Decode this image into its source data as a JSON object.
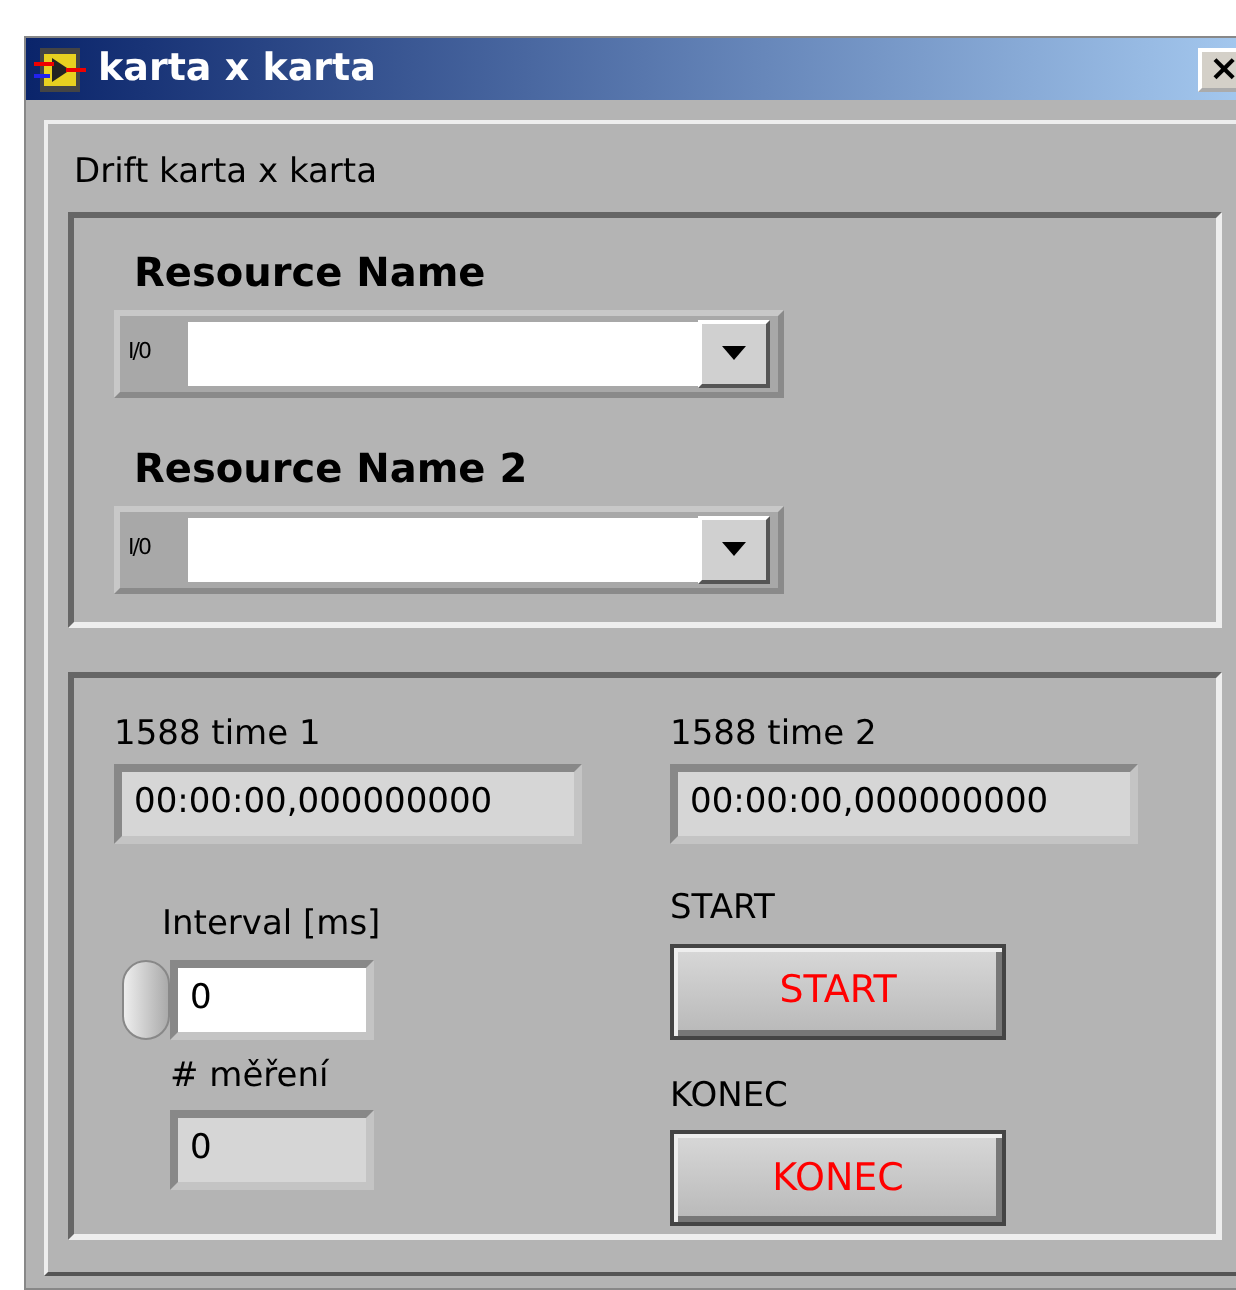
{
  "window": {
    "title": "karta x karta",
    "close": "×"
  },
  "panel": {
    "title": "Drift karta x karta"
  },
  "resources": [
    {
      "label": "Resource Name",
      "prefix": "I/0"
    },
    {
      "label": "Resource Name 2",
      "prefix": "I/0"
    }
  ],
  "times": [
    {
      "label": "1588 time 1",
      "value": "00:00:00,000000000"
    },
    {
      "label": "1588 time 2",
      "value": "00:00:00,000000000"
    }
  ],
  "interval": {
    "label": "Interval [ms]",
    "value": "0"
  },
  "count": {
    "label": "# měření",
    "value": "0"
  },
  "buttons": [
    {
      "label": "START",
      "caption": "START"
    },
    {
      "label": "KONEC",
      "caption": "KONEC"
    }
  ]
}
